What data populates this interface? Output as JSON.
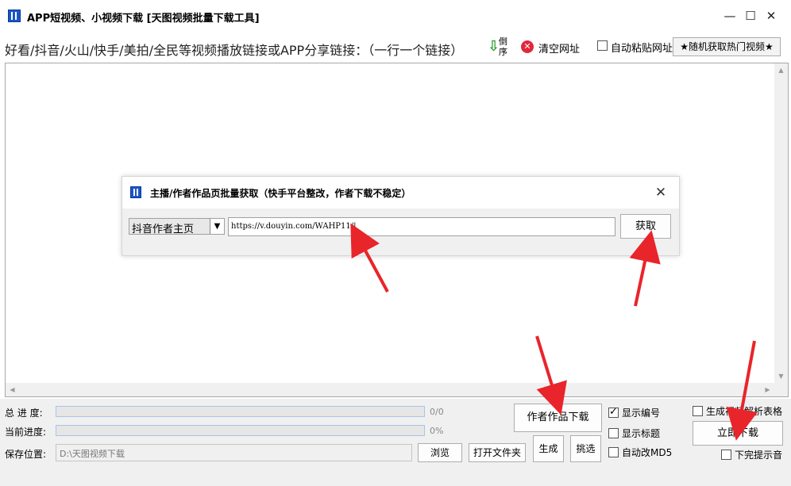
{
  "window": {
    "title": "APP短视频、小视频下载 [天图视频批量下载工具]",
    "controls": {
      "minimize": "—",
      "maximize": "☐",
      "close": "✕"
    }
  },
  "toolbar": {
    "label": "好看/抖音/火山/快手/美拍/全民等视频播放链接或APP分享链接：（一行一个链接）",
    "reverse": "倒序",
    "clear": "清空网址",
    "auto_paste": "自动粘贴网址",
    "auto_paste_checked": false,
    "hot_videos": "★随机获取热门视频★"
  },
  "url_list": {
    "value": ""
  },
  "dialog": {
    "title": "主播/作者作品页批量获取（快手平台整改，作者下载不稳定）",
    "close": "✕",
    "source_select": "抖音作者主页",
    "url_value": "https://v.douyin.com/WAHP11/",
    "fetch_button": "获取"
  },
  "status": {
    "total_label": "总 进 度:",
    "total_value": "0/0",
    "total_progress": 0,
    "current_label": "当前进度:",
    "current_value": "0%",
    "current_progress": 0,
    "save_label": "保存位置:",
    "save_path": "D:\\天图视频下载",
    "browse": "浏览",
    "open_folder": "打开文件夹"
  },
  "actions": {
    "author_download": "作者作品下载",
    "generate": "生成",
    "pick": "挑选",
    "start_download": "立即下载"
  },
  "options": {
    "show_number": {
      "label": "显示编号",
      "checked": true
    },
    "show_title": {
      "label": "显示标题",
      "checked": false
    },
    "auto_md5": {
      "label": "自动改MD5",
      "checked": false
    },
    "gen_table": {
      "label": "生成视频解析表格",
      "checked": false
    },
    "done_sound": {
      "label": "下完提示音",
      "checked": false
    }
  },
  "icons": {
    "app": "video-download-icon",
    "reverse": "arrow-down-icon",
    "clear": "red-x-icon"
  },
  "colors": {
    "annotation_arrow": "#e8252a",
    "progress_border": "#a9c4e6",
    "clear_icon": "#e0293b"
  }
}
